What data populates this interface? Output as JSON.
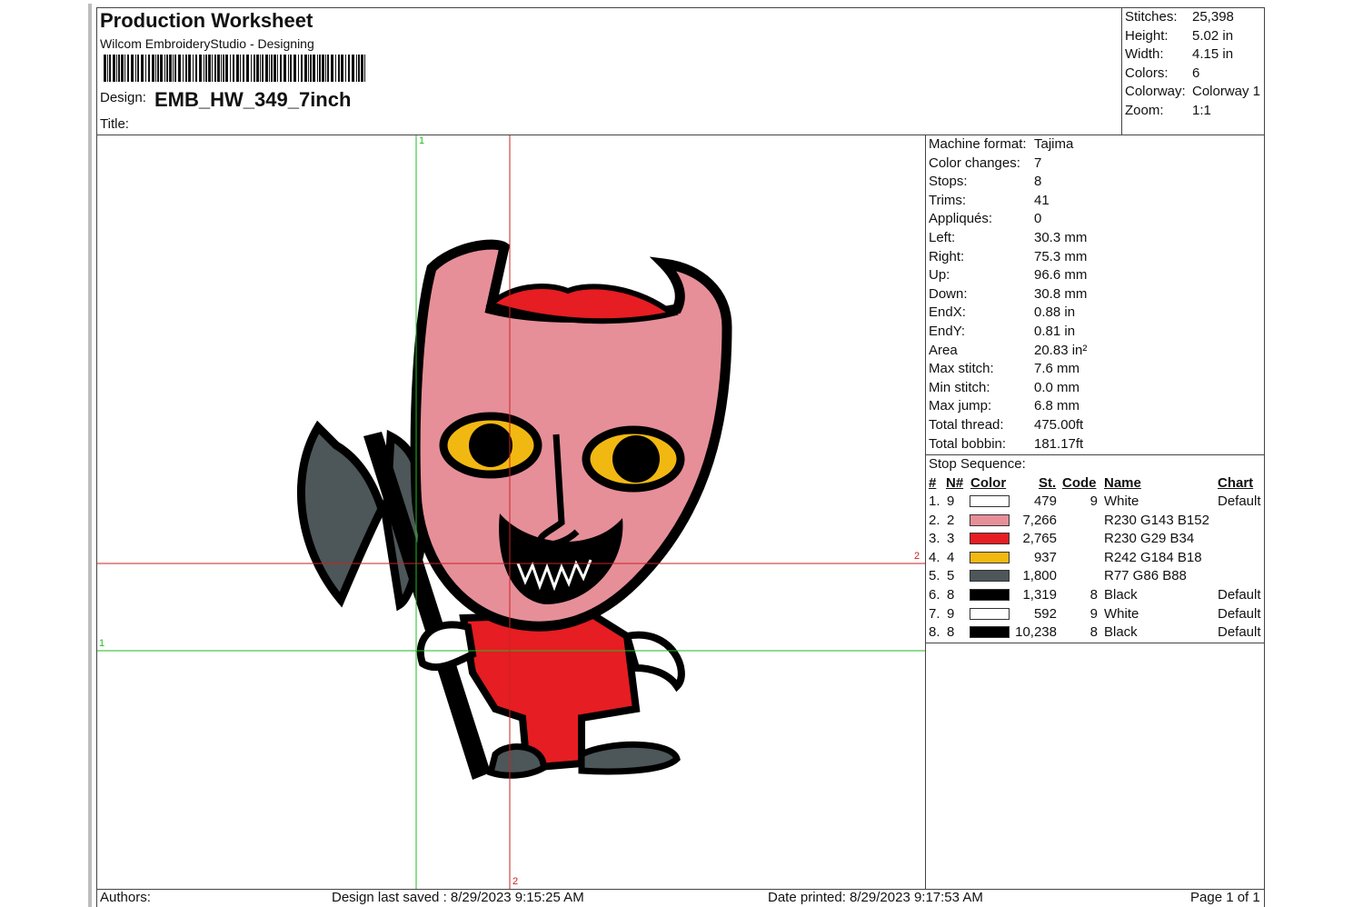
{
  "header": {
    "title": "Production Worksheet",
    "software": "Wilcom EmbroideryStudio - Designing",
    "design_label": "Design:",
    "design_name": "EMB_HW_349_7inch",
    "title_label": "Title:"
  },
  "summary": [
    {
      "label": "Stitches:",
      "value": "25,398"
    },
    {
      "label": "Height:",
      "value": "5.02 in"
    },
    {
      "label": "Width:",
      "value": "4.15 in"
    },
    {
      "label": "Colors:",
      "value": "6"
    },
    {
      "label": "Colorway:",
      "value": "Colorway 1"
    },
    {
      "label": "Zoom:",
      "value": "1:1"
    }
  ],
  "details": [
    {
      "label": "Machine format:",
      "value": "Tajima"
    },
    {
      "label": "Color changes:",
      "value": "7"
    },
    {
      "label": "Stops:",
      "value": "8"
    },
    {
      "label": "Trims:",
      "value": "41"
    },
    {
      "label": "Appliqués:",
      "value": "0"
    },
    {
      "label": "Left:",
      "value": "30.3 mm"
    },
    {
      "label": "Right:",
      "value": "75.3 mm"
    },
    {
      "label": "Up:",
      "value": "96.6 mm"
    },
    {
      "label": "Down:",
      "value": "30.8 mm"
    },
    {
      "label": "EndX:",
      "value": "0.88 in"
    },
    {
      "label": "EndY:",
      "value": "0.81 in"
    },
    {
      "label": "Area",
      "value": "20.83 in²"
    },
    {
      "label": "Max stitch:",
      "value": "7.6 mm"
    },
    {
      "label": "Min stitch:",
      "value": "0.0 mm"
    },
    {
      "label": "Max jump:",
      "value": "6.8 mm"
    },
    {
      "label": "Total thread:",
      "value": "475.00ft"
    },
    {
      "label": "Total bobbin:",
      "value": "181.17ft"
    }
  ],
  "stop_sequence": {
    "title": "Stop Sequence:",
    "headers": {
      "index": "#",
      "needle": "N#",
      "color": "Color",
      "stitches": "St.",
      "code": "Code",
      "name": "Name",
      "chart": "Chart"
    },
    "rows": [
      {
        "index": "1.",
        "needle": "9",
        "swatch": "#ffffff",
        "stitches": "479",
        "code": "9",
        "name": "White",
        "chart": "Default"
      },
      {
        "index": "2.",
        "needle": "2",
        "swatch": "#e68f98",
        "stitches": "7,266",
        "code": "",
        "name": "R230 G143 B152",
        "chart": ""
      },
      {
        "index": "3.",
        "needle": "3",
        "swatch": "#e61d22",
        "stitches": "2,765",
        "code": "",
        "name": "R230 G29 B34",
        "chart": ""
      },
      {
        "index": "4.",
        "needle": "4",
        "swatch": "#f2b812",
        "stitches": "937",
        "code": "",
        "name": "R242 G184 B18",
        "chart": ""
      },
      {
        "index": "5.",
        "needle": "5",
        "swatch": "#4d5658",
        "stitches": "1,800",
        "code": "",
        "name": "R77 G86 B88",
        "chart": ""
      },
      {
        "index": "6.",
        "needle": "8",
        "swatch": "#000000",
        "stitches": "1,319",
        "code": "8",
        "name": "Black",
        "chart": "Default"
      },
      {
        "index": "7.",
        "needle": "9",
        "swatch": "#ffffff",
        "stitches": "592",
        "code": "9",
        "name": "White",
        "chart": "Default"
      },
      {
        "index": "8.",
        "needle": "8",
        "swatch": "#000000",
        "stitches": "10,238",
        "code": "8",
        "name": "Black",
        "chart": "Default"
      }
    ]
  },
  "guides": {
    "green_label_top": "1",
    "green_label_left": "1",
    "red_label_right": "2",
    "red_label_bottom": "2"
  },
  "footer": {
    "authors": "Authors:",
    "saved": "Design last saved : 8/29/2023 9:15:25 AM",
    "printed": "Date printed: 8/29/2023 9:17:53 AM",
    "page": "Page 1 of 1"
  },
  "colors": {
    "pink": "#e68f98",
    "red": "#e61d22",
    "yellow": "#f2b812",
    "gray": "#4d5658",
    "black": "#000000"
  }
}
